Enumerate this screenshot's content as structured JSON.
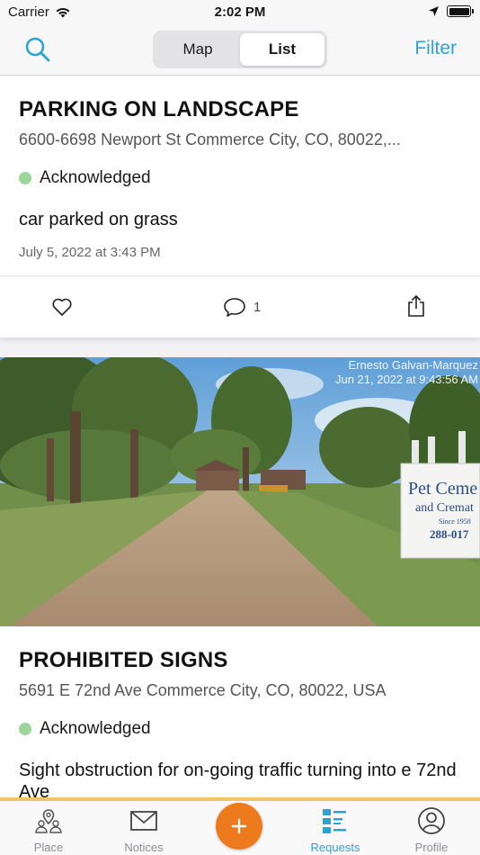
{
  "status_bar": {
    "carrier": "Carrier",
    "time": "2:02 PM"
  },
  "nav": {
    "segments": [
      "Map",
      "List"
    ],
    "selected_segment": "List",
    "filter_label": "Filter",
    "accent_color": "#2aa3d6"
  },
  "requests": [
    {
      "title": "PARKING ON LANDSCAPE",
      "address": "6600-6698 Newport St Commerce City, CO, 80022,...",
      "status": "Acknowledged",
      "status_color": "#9bd79a",
      "description": "car parked on grass",
      "date": "July 5, 2022 at 3:43 PM",
      "comment_count": "1"
    },
    {
      "title": "PROHIBITED SIGNS",
      "address": "5691 E 72nd Ave Commerce City, CO, 80022, USA",
      "status": "Acknowledged",
      "status_color": "#9bd79a",
      "description": "Sight obstruction for on-going traffic turning into e 72nd Ave",
      "photo": {
        "watermark_name": "Ernesto Galvan-Marquez",
        "watermark_date": "Jun 21, 2022 at 9:43:56 AM",
        "sign_line1": "Pet Ceme",
        "sign_line2": "and Cremat",
        "sign_since": "Since 1958",
        "sign_phone": "288-017"
      }
    }
  ],
  "tab_bar": {
    "tabs": [
      {
        "label": "Place",
        "icon": "place-icon"
      },
      {
        "label": "Notices",
        "icon": "mail-icon"
      },
      {
        "label": "Requests",
        "icon": "requests-list-icon"
      },
      {
        "label": "Profile",
        "icon": "profile-icon"
      }
    ],
    "active_tab": "Requests",
    "add_button_color": "#ee7a1e"
  }
}
